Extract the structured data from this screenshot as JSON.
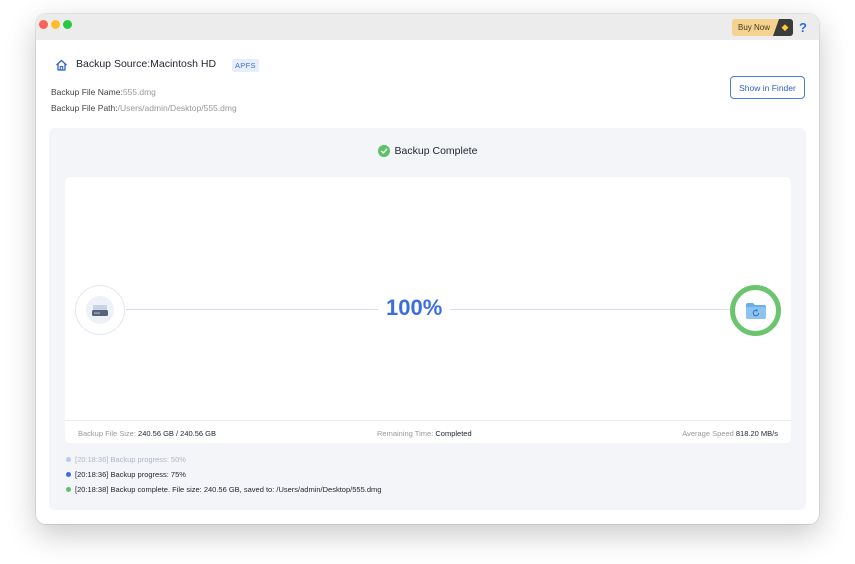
{
  "titlebar": {
    "buy_now_label": "Buy Now",
    "help_icon": "?"
  },
  "header": {
    "source_label": "Backup Source:Macintosh HD",
    "fs_badge": "APFS",
    "file_name_label": "Backup File Name:",
    "file_name_value": "555.dmg",
    "file_path_label": "Backup File Path:",
    "file_path_value": "/Users/admin/Desktop/555.dmg",
    "show_in_finder_label": "Show in Finder"
  },
  "status": {
    "label": "Backup Complete",
    "color": "#5cc167"
  },
  "progress": {
    "percent_label": "100%",
    "value": 1.0,
    "accent": "#3b6fe0"
  },
  "stats": {
    "size_label": "Backup File Size:",
    "size_value": "240.56 GB / 240.56 GB",
    "remaining_label": "Remaining Time:",
    "remaining_value": "Completed",
    "speed_label": "Average Speed",
    "speed_value": "818.20 MB/s"
  },
  "log": [
    {
      "text": "[20:18:36] Backup progress: 50%",
      "color": "#b9c9f3"
    },
    {
      "text": "[20:18:36] Backup progress: 75%",
      "color": "#3b6fe0"
    },
    {
      "text": "[20:18:38] Backup complete. File size: 240.56 GB, saved to: /Users/admin/Desktop/555.dmg",
      "color": "#5cc167"
    }
  ]
}
